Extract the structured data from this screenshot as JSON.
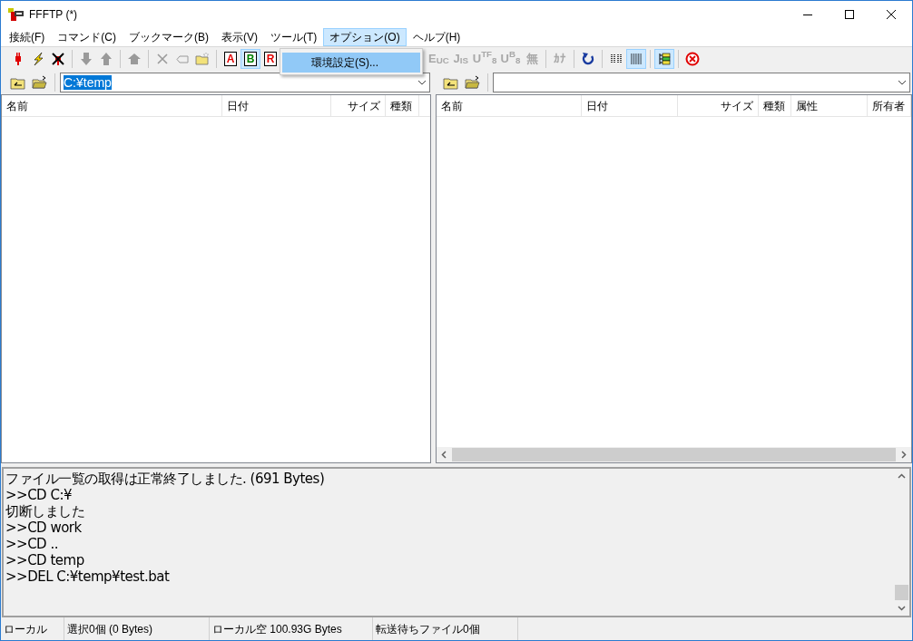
{
  "window": {
    "title": "FFFTP (*)"
  },
  "menu": [
    {
      "label": "接続(F)",
      "selected": false
    },
    {
      "label": "コマンド(C)",
      "selected": false
    },
    {
      "label": "ブックマーク(B)",
      "selected": false
    },
    {
      "label": "表示(V)",
      "selected": false
    },
    {
      "label": "ツール(T)",
      "selected": false
    },
    {
      "label": "オプション(O)",
      "selected": true
    },
    {
      "label": "ヘルプ(H)",
      "selected": false
    }
  ],
  "dropdown": {
    "items": [
      {
        "label": "環境設定(S)...",
        "selected": true
      }
    ]
  },
  "toolbar": {
    "left": [
      {
        "kind": "icon",
        "disabled": false,
        "selected": false
      },
      {
        "kind": "icon",
        "disabled": false,
        "selected": false
      },
      {
        "kind": "icon",
        "disabled": false,
        "selected": false
      },
      {
        "kind": "sep"
      },
      {
        "kind": "icon",
        "disabled": true,
        "selected": false
      },
      {
        "kind": "icon",
        "disabled": true,
        "selected": false
      },
      {
        "kind": "sep"
      },
      {
        "kind": "icon",
        "disabled": true,
        "selected": false
      },
      {
        "kind": "sep"
      },
      {
        "kind": "icon",
        "disabled": true,
        "selected": false
      },
      {
        "kind": "icon",
        "disabled": true,
        "selected": false
      },
      {
        "kind": "icon",
        "disabled": false,
        "selected": false
      },
      {
        "kind": "sep"
      },
      {
        "kind": "letter",
        "label": "A",
        "color": "#e00000",
        "selected": false
      },
      {
        "kind": "letter",
        "label": "B",
        "color": "#008000",
        "selected": true
      },
      {
        "kind": "letter",
        "label": "R",
        "color": "#e00000",
        "selected": false
      }
    ],
    "right": [
      {
        "kind": "text",
        "label": "E$_{UC}$",
        "disabled": true,
        "selected": false
      },
      {
        "kind": "text",
        "label": "J$_{IS}$",
        "disabled": true,
        "selected": false
      },
      {
        "kind": "text",
        "label": "U$^{TF}$$_{8}$",
        "disabled": true,
        "selected": false
      },
      {
        "kind": "text",
        "label": "U$^{B}$$_{8}$",
        "disabled": true,
        "selected": false
      },
      {
        "kind": "text",
        "label": "無",
        "disabled": true,
        "selected": false
      },
      {
        "kind": "sep"
      },
      {
        "kind": "text",
        "label": "ｶﾅ",
        "disabled": true,
        "selected": false
      },
      {
        "kind": "sep"
      },
      {
        "kind": "icon",
        "disabled": false,
        "selected": false
      },
      {
        "kind": "sep"
      },
      {
        "kind": "icon",
        "disabled": false,
        "selected": false
      },
      {
        "kind": "icon",
        "disabled": false,
        "selected": true
      },
      {
        "kind": "sep"
      },
      {
        "kind": "icon",
        "disabled": false,
        "selected": true
      },
      {
        "kind": "sep"
      },
      {
        "kind": "icon",
        "disabled": false,
        "selected": false
      }
    ]
  },
  "local": {
    "path": "C:¥temp",
    "columns": [
      "名前",
      "日付",
      "サイズ",
      "種類"
    ]
  },
  "remote": {
    "columns": [
      "名前",
      "日付",
      "サイズ",
      "種類",
      "属性",
      "所有者"
    ]
  },
  "log": [
    "ファイル一覧の取得は正常終了しました. (691 Bytes)",
    ">>CD C:¥",
    "切断しました",
    ">>CD work",
    ">>CD ..",
    ">>CD temp",
    ">>DEL C:¥temp¥test.bat"
  ],
  "status_bar": [
    "ローカル",
    "選択0個 (0 Bytes)",
    "ローカル空 100.93G Bytes",
    "転送待ちファイル0個"
  ]
}
